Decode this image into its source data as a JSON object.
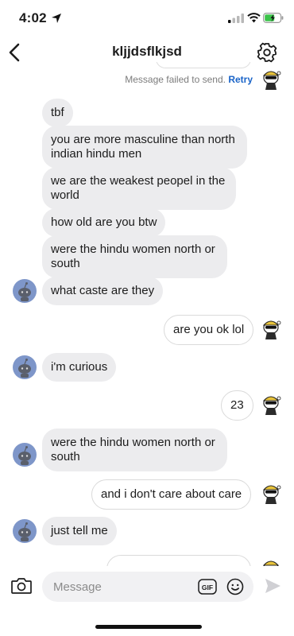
{
  "status_bar": {
    "time": "4:02"
  },
  "header": {
    "title": "kljjdsflkjsd"
  },
  "failed": {
    "text": "Message failed to send.",
    "retry": "Retry"
  },
  "messages": [
    {
      "side": "in",
      "text": "tbf"
    },
    {
      "side": "in",
      "text": "you are more masculine than north indian hindu men"
    },
    {
      "side": "in",
      "text": "we are the weakest peopel in the world"
    },
    {
      "side": "in",
      "text": "how old are you btw"
    },
    {
      "side": "in",
      "text": "were the hindu women north or south"
    },
    {
      "side": "in",
      "text": "what caste are they"
    },
    {
      "side": "out",
      "text": "are you ok lol"
    },
    {
      "side": "in",
      "text": "i'm curious"
    },
    {
      "side": "out",
      "text": "23"
    },
    {
      "side": "in",
      "text": "were the hindu women north or south"
    },
    {
      "side": "out",
      "text": "and i don't care about care"
    },
    {
      "side": "in",
      "text": "just tell me"
    }
  ],
  "composer": {
    "placeholder": "Message",
    "gif_label": "GIF"
  },
  "colors": {
    "accent": "#1a64c8",
    "incoming_bubble": "#ececee",
    "incoming_avatar": "#7e96c9"
  },
  "icons": {
    "back": "chevron-left-icon",
    "settings": "gear-icon",
    "camera": "camera-icon",
    "emoji": "smiley-icon",
    "send": "send-arrow-icon"
  }
}
